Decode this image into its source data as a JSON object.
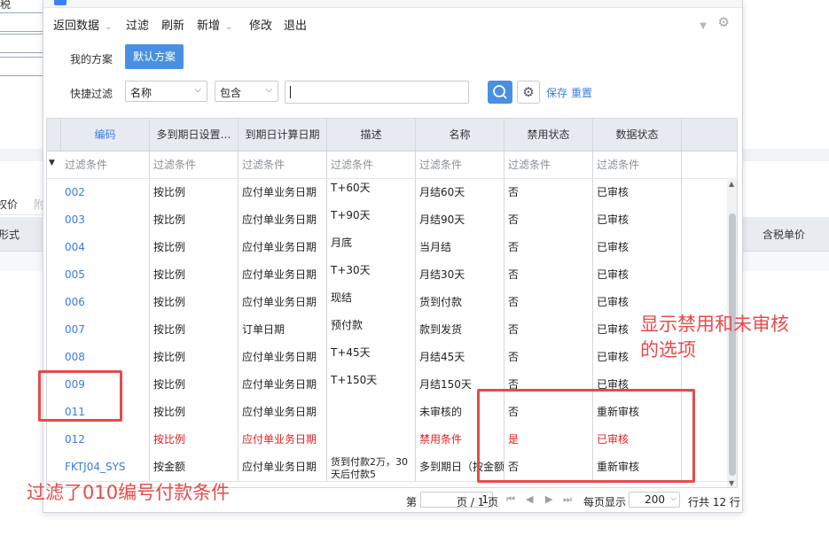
{
  "background": {
    "title": "税",
    "tab_price": "权价",
    "tab_other": "附",
    "col_form": "形式",
    "col_price": "含税单价"
  },
  "toolbar": {
    "return_data": "返回数据",
    "filter": "过滤",
    "refresh": "刷新",
    "add": "新增",
    "modify": "修改",
    "exit": "退出"
  },
  "scheme": {
    "mine": "我的方案",
    "default": "默认方案"
  },
  "quick_filter": {
    "label": "快捷过滤",
    "field": "名称",
    "operator": "包含",
    "value": "",
    "save": "保存",
    "reset": "重置"
  },
  "grid": {
    "headers": [
      "编码",
      "多到期日设置…",
      "到期日计算日期",
      "描述",
      "名称",
      "禁用状态",
      "数据状态"
    ],
    "filter_placeholder": "过滤条件",
    "rows": [
      {
        "code": "002",
        "rule": "按比例",
        "calc_date": "应付单业务日期",
        "desc": "T+60天",
        "name": "月结60天",
        "disabled": "否",
        "status": "已审核"
      },
      {
        "code": "003",
        "rule": "按比例",
        "calc_date": "应付单业务日期",
        "desc": "T+90天",
        "name": "月结90天",
        "disabled": "否",
        "status": "已审核"
      },
      {
        "code": "004",
        "rule": "按比例",
        "calc_date": "应付单业务日期",
        "desc": "月底",
        "name": "当月结",
        "disabled": "否",
        "status": "已审核"
      },
      {
        "code": "005",
        "rule": "按比例",
        "calc_date": "应付单业务日期",
        "desc": "T+30天",
        "name": "月结30天",
        "disabled": "否",
        "status": "已审核"
      },
      {
        "code": "006",
        "rule": "按比例",
        "calc_date": "应付单业务日期",
        "desc": "现结",
        "name": "货到付款",
        "disabled": "否",
        "status": "已审核"
      },
      {
        "code": "007",
        "rule": "按比例",
        "calc_date": "订单日期",
        "desc": "预付款",
        "name": "款到发货",
        "disabled": "否",
        "status": "已审核"
      },
      {
        "code": "008",
        "rule": "按比例",
        "calc_date": "应付单业务日期",
        "desc": "T+45天",
        "name": "月结45天",
        "disabled": "否",
        "status": "已审核"
      },
      {
        "code": "009",
        "rule": "按比例",
        "calc_date": "应付单业务日期",
        "desc": "T+150天",
        "name": "月结150天",
        "disabled": "否",
        "status": "已审核"
      },
      {
        "code": "011",
        "rule": "按比例",
        "calc_date": "应付单业务日期",
        "desc": "",
        "name": "未审核的",
        "disabled": "否",
        "status": "重新审核"
      },
      {
        "code": "012",
        "rule": "按比例",
        "calc_date": "应付单业务日期",
        "desc": "",
        "name": "禁用条件",
        "disabled": "是",
        "status": "已审核"
      },
      {
        "code": "FKTJ04_SYS",
        "rule": "按金额",
        "calc_date": "应付单业务日期",
        "desc": "货到付款2万，30天后付款5",
        "name": "多到期日（按金额",
        "disabled": "否",
        "status": "重新审核"
      }
    ]
  },
  "pager": {
    "prefix": "第",
    "page": "1",
    "suffix": "页 / 1 页",
    "per_page_label": "每页显示",
    "per_page": "200",
    "total": "行共 12 行"
  },
  "annotations": {
    "right": "显示禁用和未审核\n的选项",
    "left": "过滤了010编号付款条件"
  }
}
